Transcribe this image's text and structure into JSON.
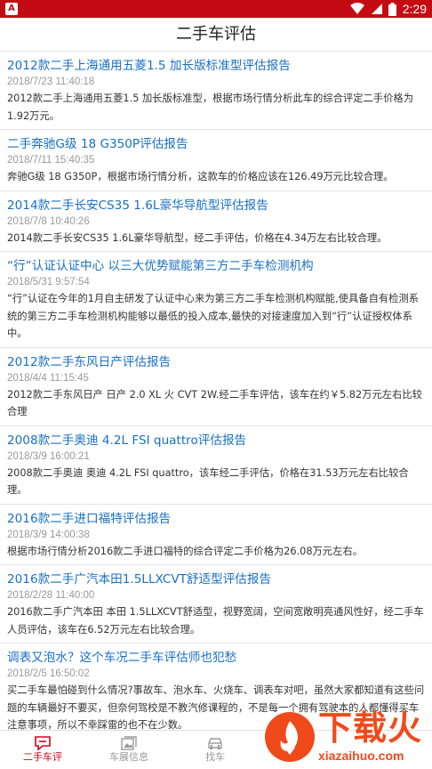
{
  "status_bar": {
    "time": "2:29",
    "left_icon": "A",
    "icons": [
      "wifi-icon",
      "signal-icon",
      "battery-icon"
    ],
    "color": "#c40b14"
  },
  "header": {
    "title": "二手车评估"
  },
  "articles": [
    {
      "title": "2012款二手上海通用五菱1.5 加长版标准型评估报告",
      "date": "2018/7/23 11:40:18",
      "desc": "2012款二手上海通用五菱1.5 加长版标准型，根据市场行情分析此车的综合评定二手价格为1.92万元。"
    },
    {
      "title": "二手奔驰G级 18 G350P评估报告",
      "date": "2018/7/11 15:40:35",
      "desc": "奔驰G级 18 G350P，根据市场行情分析，这款车的价格应该在126.49万元比较合理。"
    },
    {
      "title": "2014款二手长安CS35 1.6L豪华导航型评估报告",
      "date": "2018/7/8 10:40:26",
      "desc": "2014款二手长安CS35 1.6L豪华导航型，经二手评估，价格在4.34万左右比较合理。"
    },
    {
      "title": "“行”认证认证中心 以三大优势赋能第三方二手车检测机构",
      "date": "2018/5/31 9:57:54",
      "desc": "“行”认证在今年的1月自主研发了认证中心来为第三方二手车检测机构赋能,使具备自有检测系统的第三方二手车检测机构能够以最低的投入成本,最快的对接速度加入到“行”认证授权体系中。"
    },
    {
      "title": "2012款二手东风日产评估报告",
      "date": "2018/4/4 11:15:45",
      "desc": "2012款二手东风日产 日产 2.0 XL 火 CVT 2W.经二手车评估，该车在约￥5.82万元左右比较合理"
    },
    {
      "title": "2008款二手奥迪 4.2L FSI quattro评估报告",
      "date": "2018/3/9 16:00:21",
      "desc": "2008款二手奥迪 奥迪 4.2L FSI quattro，该车经二手评估，价格在31.53万元左右比较合理。"
    },
    {
      "title": "2016款二手进口福特评估报告",
      "date": "2018/3/9 14:00:38",
      "desc": "根据市场行情分析2016款二手进口福特的综合评定二手价格为26.08万元左右。"
    },
    {
      "title": "2016款二手广汽本田1.5LLXCVT舒适型评估报告",
      "date": "2018/2/28 11:40:00",
      "desc": "2016款二手广汽本田 本田 1.5LLXCVT舒适型，视野宽阔，空间宽敞明亮通风性好，经二手车人员评估，该车在6.52万元左右比较合理。"
    },
    {
      "title": "调表又泡水？这个车况二手车评估师也犯愁",
      "date": "2018/2/5 16:50:02",
      "desc": "买二手车最怕碰到什么情况?事故车、泡水车、火烧车、调表车对吧，虽然大家都知道有这些问题的车辆最好不要买，但奈何驾校是不教汽修课程的，不是每一个拥有驾驶本的人都懂得买车注意事项，所以不幸踩雷的也不在少数。"
    }
  ],
  "tabs": [
    {
      "label": "二手车评",
      "icon": "chat-icon",
      "active": true
    },
    {
      "label": "车展信息",
      "icon": "gallery-icon",
      "active": false
    },
    {
      "label": "找车",
      "icon": "car-icon",
      "active": false
    }
  ],
  "watermark": {
    "title": "下载火",
    "subtitle": "xiazaihuo.com"
  },
  "colors": {
    "accent": "#d0021b",
    "link": "#1a70c4",
    "watermark": "#f04a1a"
  }
}
